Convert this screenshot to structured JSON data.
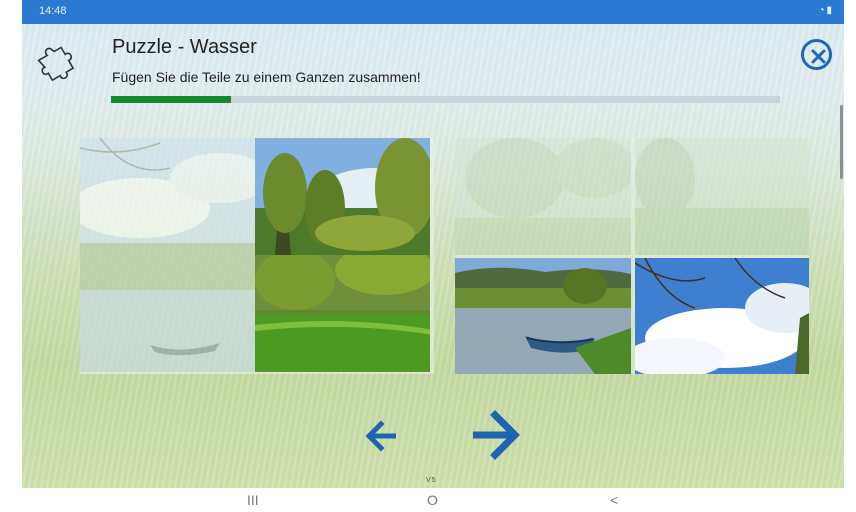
{
  "status_bar": {
    "time": "14:48",
    "icons": "wifi-icon battery-icon"
  },
  "header": {
    "title": "Puzzle - Wasser",
    "subtitle": "Fügen Sie die Teile zu einem Ganzen zusammen!",
    "progress": 0.18,
    "icon": "puzzle-icon",
    "close_icon": "close-circle-icon"
  },
  "colors": {
    "status_bar": "#2a79d3",
    "progress_fill": "#118a2c",
    "progress_track": "#c9d3da",
    "accent": "#1f67b8"
  },
  "assembly_board": {
    "tiles": [
      {
        "position": "top-left",
        "state": "empty-faded"
      },
      {
        "position": "top-right",
        "state": "placed"
      },
      {
        "position": "bottom-left",
        "state": "empty-faded"
      },
      {
        "position": "bottom-right",
        "state": "placed"
      }
    ]
  },
  "pieces_tray": {
    "tiles": [
      {
        "position": "top-left",
        "state": "used-faded"
      },
      {
        "position": "top-right",
        "state": "used-faded"
      },
      {
        "position": "bottom-left",
        "state": "available"
      },
      {
        "position": "bottom-right",
        "state": "available"
      }
    ]
  },
  "footer": {
    "watermark": "V5",
    "back_icon": "arrow-left-icon",
    "next_icon": "arrow-right-icon"
  },
  "nav_bar": {
    "recents": "III",
    "home": "O",
    "back": "<"
  }
}
